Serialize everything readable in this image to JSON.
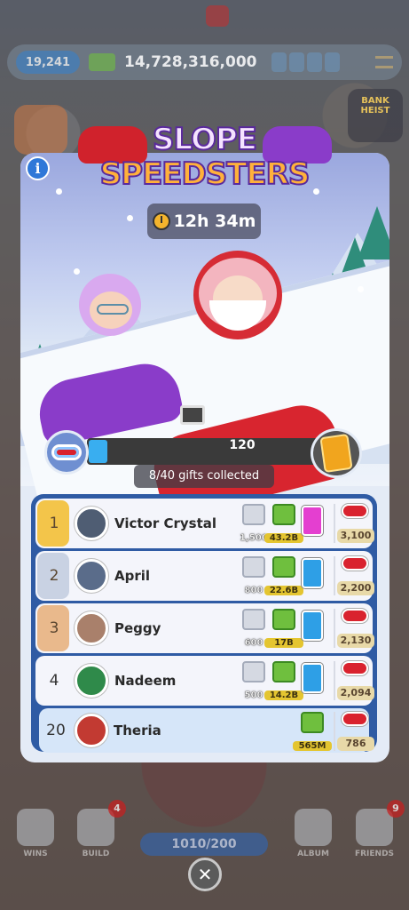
{
  "hud": {
    "money_pill": "19,241",
    "cash": "14,728,316,000",
    "heist_label": "BANK HEIST"
  },
  "event": {
    "title_line1": "SLOPE",
    "title_line2": "SPEEDSTERS",
    "info_label": "i",
    "timer": "12h 34m",
    "progress": {
      "milestone_points": "120",
      "fill_fraction": 0.08,
      "gifts_collected": "8/40 gifts collected"
    }
  },
  "leaderboard": {
    "rows": [
      {
        "rank": "1",
        "name": "Victor Crystal",
        "dice": "1,500",
        "cash": "43.2B",
        "sticker_color": "#e43fd0",
        "points": "3,100"
      },
      {
        "rank": "2",
        "name": "April",
        "dice": "800",
        "cash": "22.6B",
        "sticker_color": "#2e9fe6",
        "points": "2,200"
      },
      {
        "rank": "3",
        "name": "Peggy",
        "dice": "600",
        "cash": "17B",
        "sticker_color": "#2e9fe6",
        "points": "2,130"
      },
      {
        "rank": "4",
        "name": "Nadeem",
        "dice": "500",
        "cash": "14.2B",
        "sticker_color": "#2e9fe6",
        "points": "2,094"
      }
    ],
    "me": {
      "rank": "20",
      "name": "Theria",
      "cash": "565M",
      "points": "786"
    }
  },
  "bottom": {
    "nav": [
      {
        "label": "WINS",
        "badge": ""
      },
      {
        "label": "BUILD",
        "badge": "4"
      },
      {
        "label": "ALBUM",
        "badge": ""
      },
      {
        "label": "FRIENDS",
        "badge": "9"
      }
    ],
    "counter": "1010/200",
    "close_label": "✕"
  },
  "colors": {
    "panel_bg": "#e4ebf6",
    "board_border": "#2f5ba4",
    "progress_fill": "#39aef0",
    "title_orange": "#ffb13b",
    "title_outline": "#5a2a9c"
  }
}
